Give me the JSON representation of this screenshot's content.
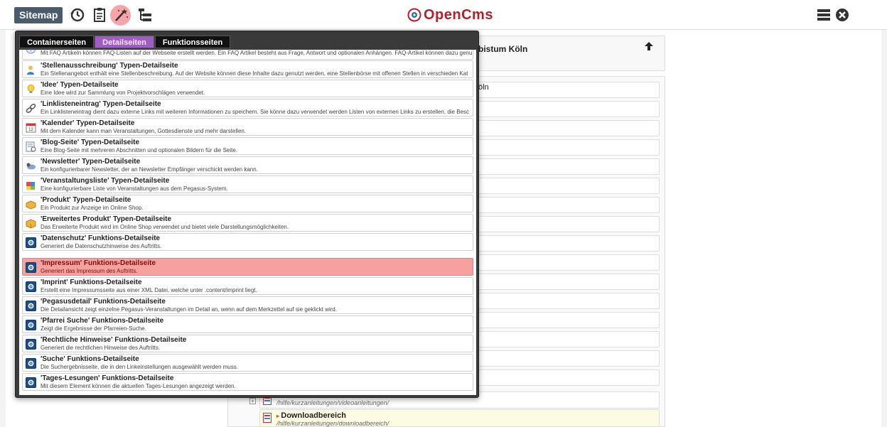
{
  "toolbar": {
    "sitemap_label": "Sitemap",
    "icons": [
      "history-icon",
      "clipboard-icon",
      "wand-icon",
      "tree-icon"
    ],
    "logo_text": "OpenCms",
    "right_icons": [
      "menu-icon",
      "close-icon"
    ]
  },
  "gallery": {
    "tabs": [
      {
        "label": "Containerseiten",
        "active": false
      },
      {
        "label": "Detailseiten",
        "active": true
      },
      {
        "label": "Funktionsseiten",
        "active": false
      }
    ],
    "items": [
      {
        "title": "",
        "desc": "Mit FAQ Artikeln können FAQ-Listen auf der Webseite erstellt werden. Ein FAQ Artikel besteht aus Frage, Antwort und optionalen Anhängen. FAQ-Artikel können dazu genu",
        "icon": "faq-icon"
      },
      {
        "title": "'Stellenausschreibung' Typen-Detailseite",
        "desc": "Ein Stellenangebot enthält eine Stellenbeschreibung. Auf der Website können diese Inhalte dazu genutzt werden, eine Stellenbörse mit offenen Stellen in verschieden Kat",
        "icon": "job-icon"
      },
      {
        "title": "'Idee' Typen-Detailseite",
        "desc": "Eine Idee wird zur Sammlung von Projektvorschlägen verwendet.",
        "icon": "idea-icon"
      },
      {
        "title": "'Linklisteneintrag' Typen-Detailseite",
        "desc": "Ein Linklisteneintrag dient dazu externe Links mit weiteren Informationen zu speichern. Sie könne dazu verwendet werden Listen von externen Links zu erstellen, die Besc",
        "icon": "link-icon"
      },
      {
        "title": "'Kalender' Typen-Detailseite",
        "desc": "Mit dem Kalender kann man Veranstaltungen, Gottesdienste und mehr darstellen.",
        "icon": "calendar-icon"
      },
      {
        "title": "'Blog-Seite' Typen-Detailseite",
        "desc": "Eine Blog-Seite mit mehreren Abschnitten und optionalen Bildern für die Seite.",
        "icon": "blog-icon"
      },
      {
        "title": "'Newsletter' Typen-Detailseite",
        "desc": "Ein konfigurierbarer Newsletter, der an Newsletter Empfänger verschickt werden kann.",
        "icon": "newsletter-icon"
      },
      {
        "title": "'Veranstaltungsliste' Typen-Detailseite",
        "desc": "Eine konfigurierbare Liste von Veranstaltungen aus dem Pegasus-System.",
        "icon": "event-list-icon"
      },
      {
        "title": "'Produkt' Typen-Detailseite",
        "desc": "Ein Produkt zur Anzeige im Online Shop.",
        "icon": "product-icon"
      },
      {
        "title": "'Erweitertes Produkt' Typen-Detailseite",
        "desc": "Das Erweiterte Produkt wird im Online Shop verwendet und bietet viele Darstellungsmöglichkeiten.",
        "icon": "product-ext-icon"
      },
      {
        "title": "'Datenschutz' Funktions-Detailseite",
        "desc": "Generiert die Datenschutzhinweise des Auftritts.",
        "icon": "cog-icon"
      },
      {
        "title": "'Impressum' Funktions-Detailseite",
        "desc": "Generiert das Impressum des Auftritts.",
        "icon": "cog-icon",
        "selected": true
      },
      {
        "title": "'Imprint' Funktions-Detailseite",
        "desc": "Erstellt eine Impressumsseite aus einer XML Datei, welche unter .content/imprint liegt.",
        "icon": "cog-icon"
      },
      {
        "title": "'Pegasusdetail' Funktions-Detailseite",
        "desc": "Die Detailansicht zeigt einzelne Pegasus-Veranstaltungen im Detail an, wenn auf dem Merkzettel auf sie geklickt wird.",
        "icon": "cog-icon"
      },
      {
        "title": "'Pfarrei Suche' Funktions-Detailseite",
        "desc": "Zeigt die Ergebnisse der Pfarreien-Suche.",
        "icon": "cog-icon"
      },
      {
        "title": "'Rechtliche Hinweise' Funktions-Detailseite",
        "desc": "Generiert die rechtlichen Hinweise des Auftritts.",
        "icon": "cog-icon"
      },
      {
        "title": "'Suche' Funktions-Detailseite",
        "desc": "Die Suchergebnisseite, die in den Linkeinstellungen ausgewählt werden muss.",
        "icon": "cog-icon"
      },
      {
        "title": "'Tages-Lesungen' Funktions-Detailseite",
        "desc": "Mit diesem Element können die aktuellen Tages-Lesungen angezeigt werden.",
        "icon": "cog-icon"
      }
    ]
  },
  "page": {
    "site_title_partial": "bistum Köln",
    "tree_label_partial": "öln",
    "tree_rows": [
      {
        "path": "/hilfe/kurzanleitungen/videoanleitungen/"
      },
      {
        "title": "Downloadbereich",
        "path": "/hilfe/kurzanleitungen/downloadbereich/",
        "highlight": true
      }
    ]
  }
}
